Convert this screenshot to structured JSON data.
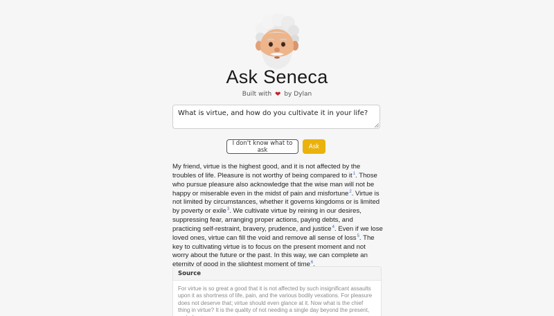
{
  "app": {
    "title": "Ask Seneca",
    "byline_prefix": "Built with",
    "byline_suffix": "by Dylan",
    "heart_icon": "heart-icon",
    "heart_color": "#c2202d"
  },
  "question": {
    "value": "What is virtue, and how do you cultivate it in your life?"
  },
  "buttons": {
    "dont_know_label": "I don't know what to ask",
    "ask_label": "Ask",
    "ask_color": "#eab20c"
  },
  "answer": {
    "segments": [
      {
        "text": "My friend, virtue is the highest good, and it is not affected by the troubles of life. Pleasure is not worthy of being compared to it",
        "ref": "1"
      },
      {
        "text": ". Those who pursue pleasure also acknowledge that the wise man will not be happy or miserable even in the midst of pain and misfortune",
        "ref": "2"
      },
      {
        "text": ". Virtue is not limited by circumstances, whether it governs kingdoms or is limited by poverty or exile",
        "ref": "3"
      },
      {
        "text": ". We cultivate virtue by reining in our desires, suppressing fear, arranging proper actions, paying debts, and practicing self-restraint, bravery, prudence, and justice",
        "ref": "4"
      },
      {
        "text": ". Even if we lose loved ones, virtue can fill the void and remove all sense of loss",
        "ref": "5"
      },
      {
        "text": ". The key to cultivating virtue is to focus on the present moment and not worry about the future or the past. In this way, we can complete an eternity of good in the slightest moment of time",
        "ref": "6"
      },
      {
        "text": ".",
        "ref": null
      }
    ],
    "ref_color": "#3a67c7"
  },
  "source": {
    "header": "Source",
    "text": "For virtue is so great a good that it is not affected by such insignificant assaults upon it as shortness of life, pain, and the various bodily vexations. For pleasure does not deserve that; virtue should even glance at it. Now what is the chief thing in virtue? It is the quality of not needing a single day beyond the present, and of not"
  }
}
